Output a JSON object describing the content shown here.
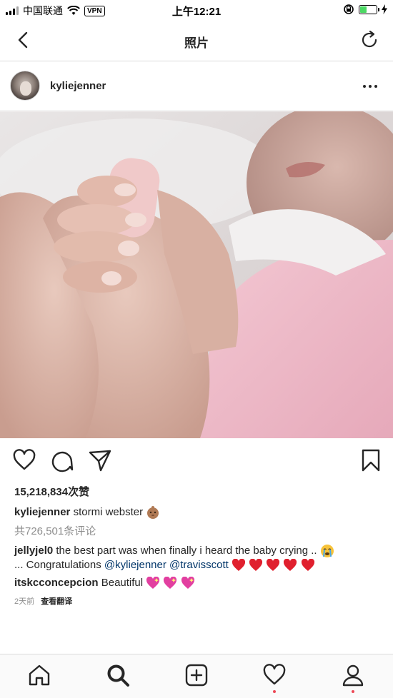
{
  "status_bar": {
    "carrier": "中国联通",
    "vpn": "VPN",
    "time": "上午12:21"
  },
  "nav": {
    "title": "照片"
  },
  "post": {
    "username": "kyliejenner",
    "likes": "15,218,834次赞",
    "caption_user": "kyliejenner",
    "caption_text": "stormi webster",
    "view_comments": "共726,501条评论",
    "comments": [
      {
        "user": "jellyjel0",
        "text_a": "the best part was when finally i heard the baby crying ..",
        "text_b": "... Congratulations",
        "mention_1": "@kyliejenner",
        "mention_2": "@travisscott"
      },
      {
        "user": "itskcconcepcion",
        "text": "Beautiful"
      }
    ],
    "timestamp": "2天前",
    "translate": "查看翻译"
  },
  "icons": {
    "status": [
      "signal-icon",
      "wifi-icon",
      "alarm-lock-icon",
      "battery-icon",
      "charging-icon"
    ],
    "nav": [
      "back-icon",
      "refresh-icon"
    ],
    "actions": [
      "heart-icon",
      "comment-icon",
      "share-icon",
      "bookmark-icon"
    ],
    "tabs": [
      "home-icon",
      "search-icon",
      "new-post-icon",
      "activity-heart-icon",
      "profile-icon"
    ]
  },
  "colors": {
    "battery": "#4cd964",
    "notification_dot": "#ed4956",
    "mention": "#003569",
    "heart_emoji": "#e0202e",
    "sparkle_heart": "#e23fa0"
  }
}
